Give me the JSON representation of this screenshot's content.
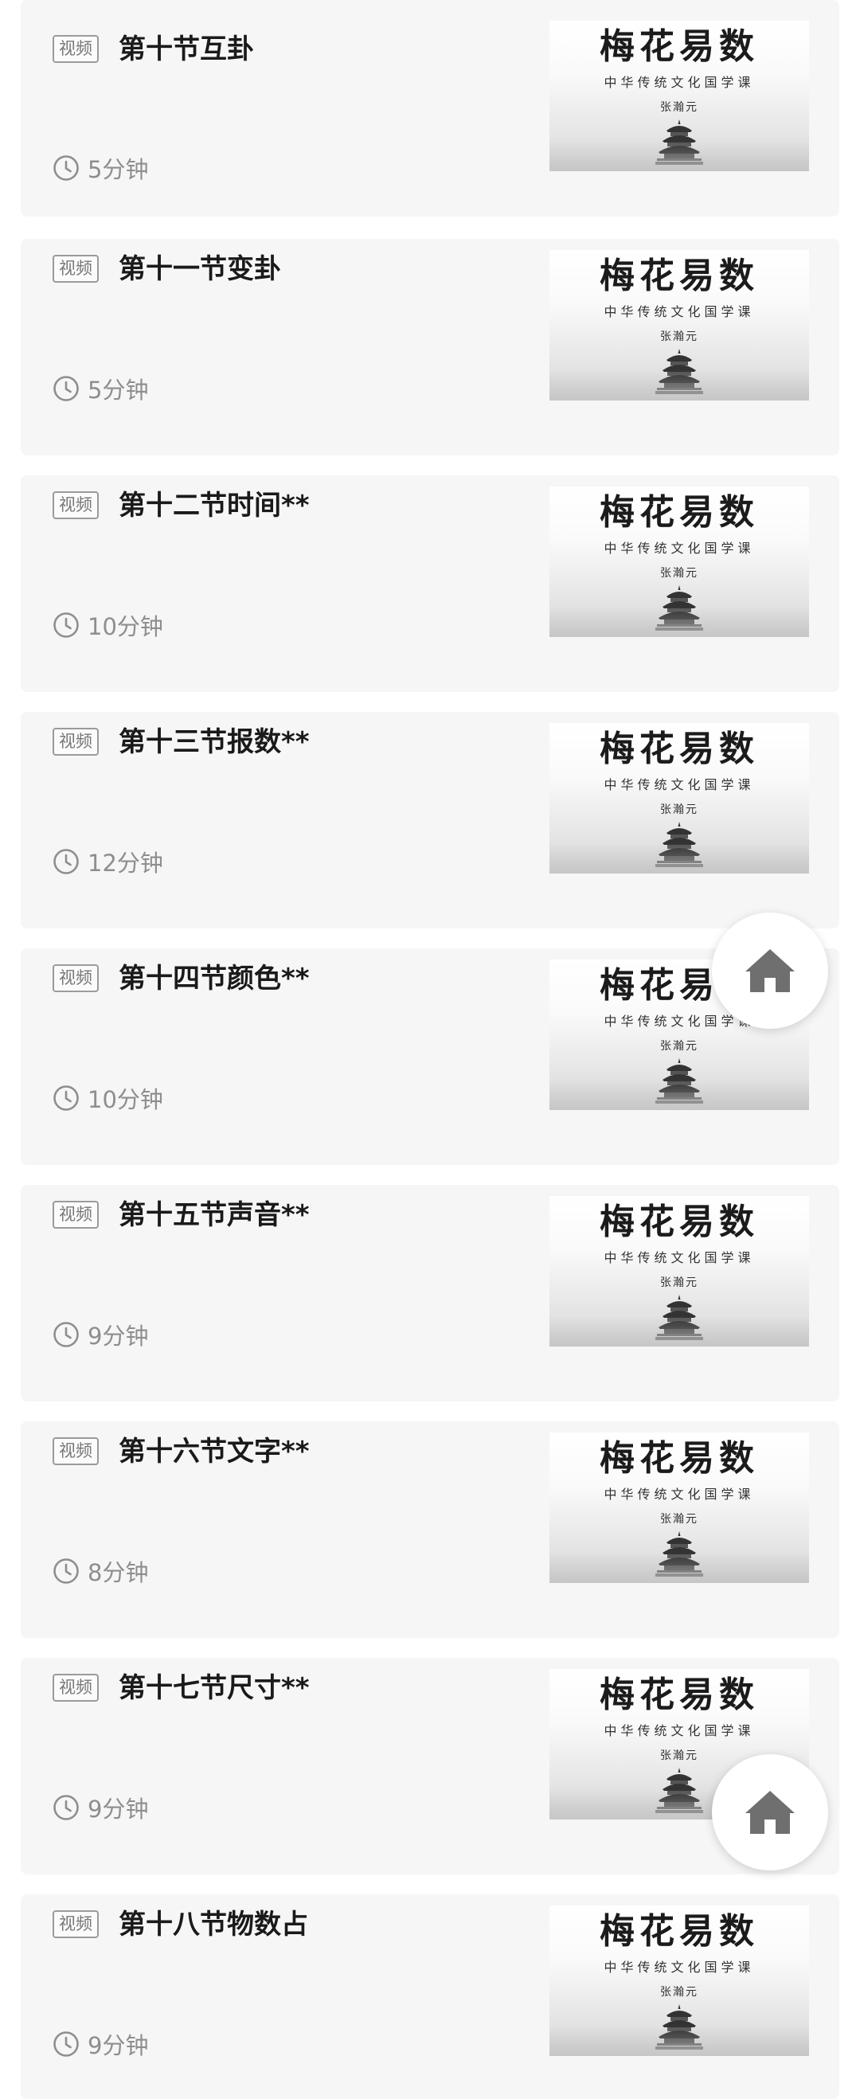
{
  "lessons": [
    {
      "tag": "视频",
      "title": "第十节互卦",
      "duration": "5分钟"
    },
    {
      "tag": "视频",
      "title": "第十一节变卦",
      "duration": "5分钟"
    },
    {
      "tag": "视频",
      "title": "第十二节时间**",
      "duration": "10分钟"
    },
    {
      "tag": "视频",
      "title": "第十三节报数**",
      "duration": "12分钟"
    },
    {
      "tag": "视频",
      "title": "第十四节颜色**",
      "duration": "10分钟"
    },
    {
      "tag": "视频",
      "title": "第十五节声音**",
      "duration": "9分钟"
    },
    {
      "tag": "视频",
      "title": "第十六节文字**",
      "duration": "8分钟"
    },
    {
      "tag": "视频",
      "title": "第十七节尺寸**",
      "duration": "9分钟"
    },
    {
      "tag": "视频",
      "title": "第十八节物数占",
      "duration": "9分钟"
    }
  ],
  "thumbnail": {
    "title": "梅花易数",
    "subtitle": "中华传统文化国学课",
    "author": "张瀚元"
  },
  "icons": {
    "duration": "clock-icon",
    "home": "home-icon"
  },
  "colors": {
    "card_background": "#f6f6f6",
    "title_text": "#1a1a1a",
    "meta_text": "#8e8e8e",
    "home_icon": "#6f6f6f"
  }
}
